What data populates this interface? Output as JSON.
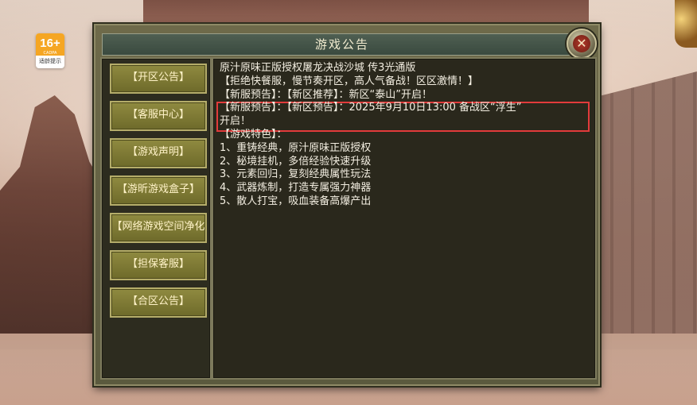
{
  "badge": {
    "age": "16+",
    "sub": "CADPA",
    "caption": "适龄提示"
  },
  "dialog": {
    "title": "游戏公告",
    "menu": [
      "【开区公告】",
      "【客服中心】",
      "【游戏声明】",
      "【游昕游戏盒子】",
      "【网络游戏空间净化",
      "【担保客服】",
      "【合区公告】"
    ],
    "content_lines": [
      "原汁原味正版授权屠龙决战沙城 传3光通版",
      "【拒绝快餐服，慢节奏开区，高人气备战！区区激情！】",
      "【新服预告】：【新区推荐】：新区“泰山”开启！",
      "【新服预告】：【新区预告】：2025年9月10日13:00 备战区“浮生”",
      "开启！",
      "【游戏特色】：",
      "1、重铸经典，原汁原味正版授权",
      "2、秘境挂机，多倍经验快速升级",
      "3、元素回归，复刻经典属性玩法",
      "4、武器炼制，打造专属强力神器",
      "5、散人打宝，吸血装备高爆产出"
    ]
  },
  "colors": {
    "highlight_border": "#e23b3b",
    "menu_button": "#8f8a40",
    "text": "#f4efe2"
  }
}
